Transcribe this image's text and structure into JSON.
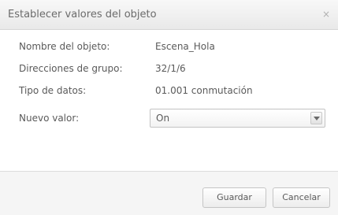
{
  "dialog": {
    "title": "Establecer valores del objeto",
    "close_glyph": "×"
  },
  "fields": {
    "object_name": {
      "label": "Nombre del objeto:",
      "value": "Escena_Hola"
    },
    "group_address": {
      "label": "Direcciones de grupo:",
      "value": "32/1/6"
    },
    "data_type": {
      "label": "Tipo de datos:",
      "value": "01.001 conmutación"
    },
    "new_value": {
      "label": "Nuevo valor:",
      "selected": "On"
    }
  },
  "buttons": {
    "save_label": "Guardar",
    "cancel_label": "Cancelar"
  },
  "icons": {
    "close": "close-icon",
    "dropdown": "chevron-down-icon"
  },
  "colors": {
    "text": "#5a5a5a",
    "title_bar": "#eeeeee",
    "footer": "#f5f5f5",
    "border": "#c5c5c5"
  }
}
